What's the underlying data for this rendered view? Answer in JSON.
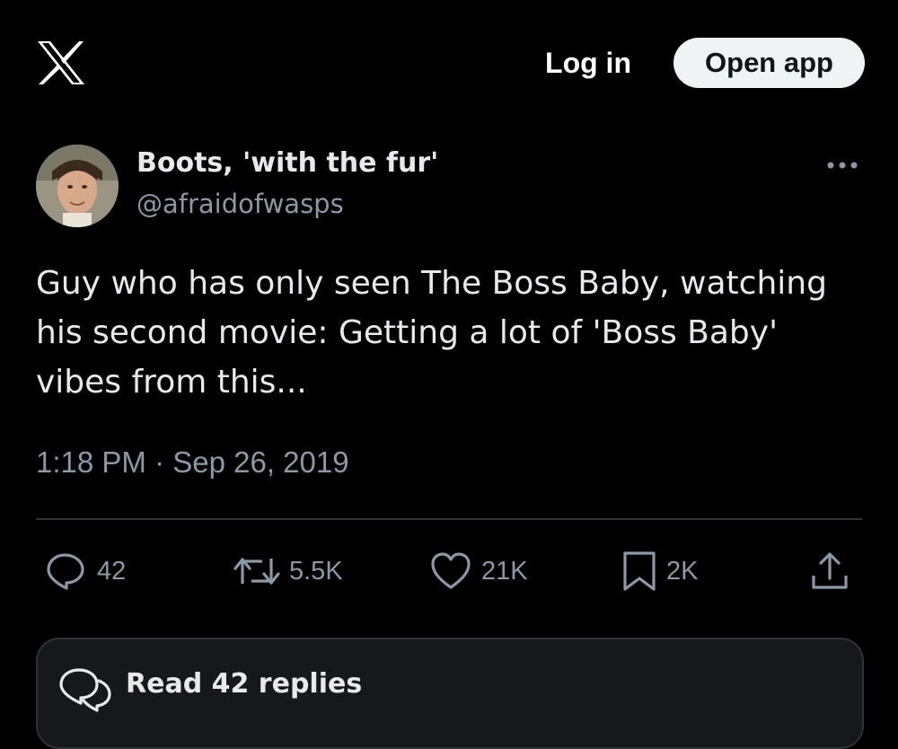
{
  "header": {
    "logo_icon": "x-logo-icon",
    "login_label": "Log in",
    "open_app_label": "Open app"
  },
  "tweet": {
    "author_name": "Boots, 'with the fur'",
    "author_handle": "@afraidofwasps",
    "more_icon": "more-dots-icon",
    "text": "Guy who has only seen The Boss Baby, watching his second movie: Getting a lot of 'Boss Baby' vibes from this...",
    "timestamp": "1:18 PM · Sep 26, 2019"
  },
  "actions": {
    "replies": {
      "icon": "reply-icon",
      "count": "42"
    },
    "reposts": {
      "icon": "repost-icon",
      "count": "5.5K"
    },
    "likes": {
      "icon": "heart-icon",
      "count": "21K"
    },
    "bookmarks": {
      "icon": "bookmark-icon",
      "count": "2K"
    },
    "share": {
      "icon": "share-icon"
    }
  },
  "replies_card": {
    "icon": "reply-bubbles-icon",
    "label": "Read 42 replies"
  },
  "colors": {
    "background": "#000000",
    "text": "#e7e9ea",
    "secondary_text": "#8b98a5",
    "divider": "#2f3336",
    "button_bg": "#eff3f4"
  }
}
